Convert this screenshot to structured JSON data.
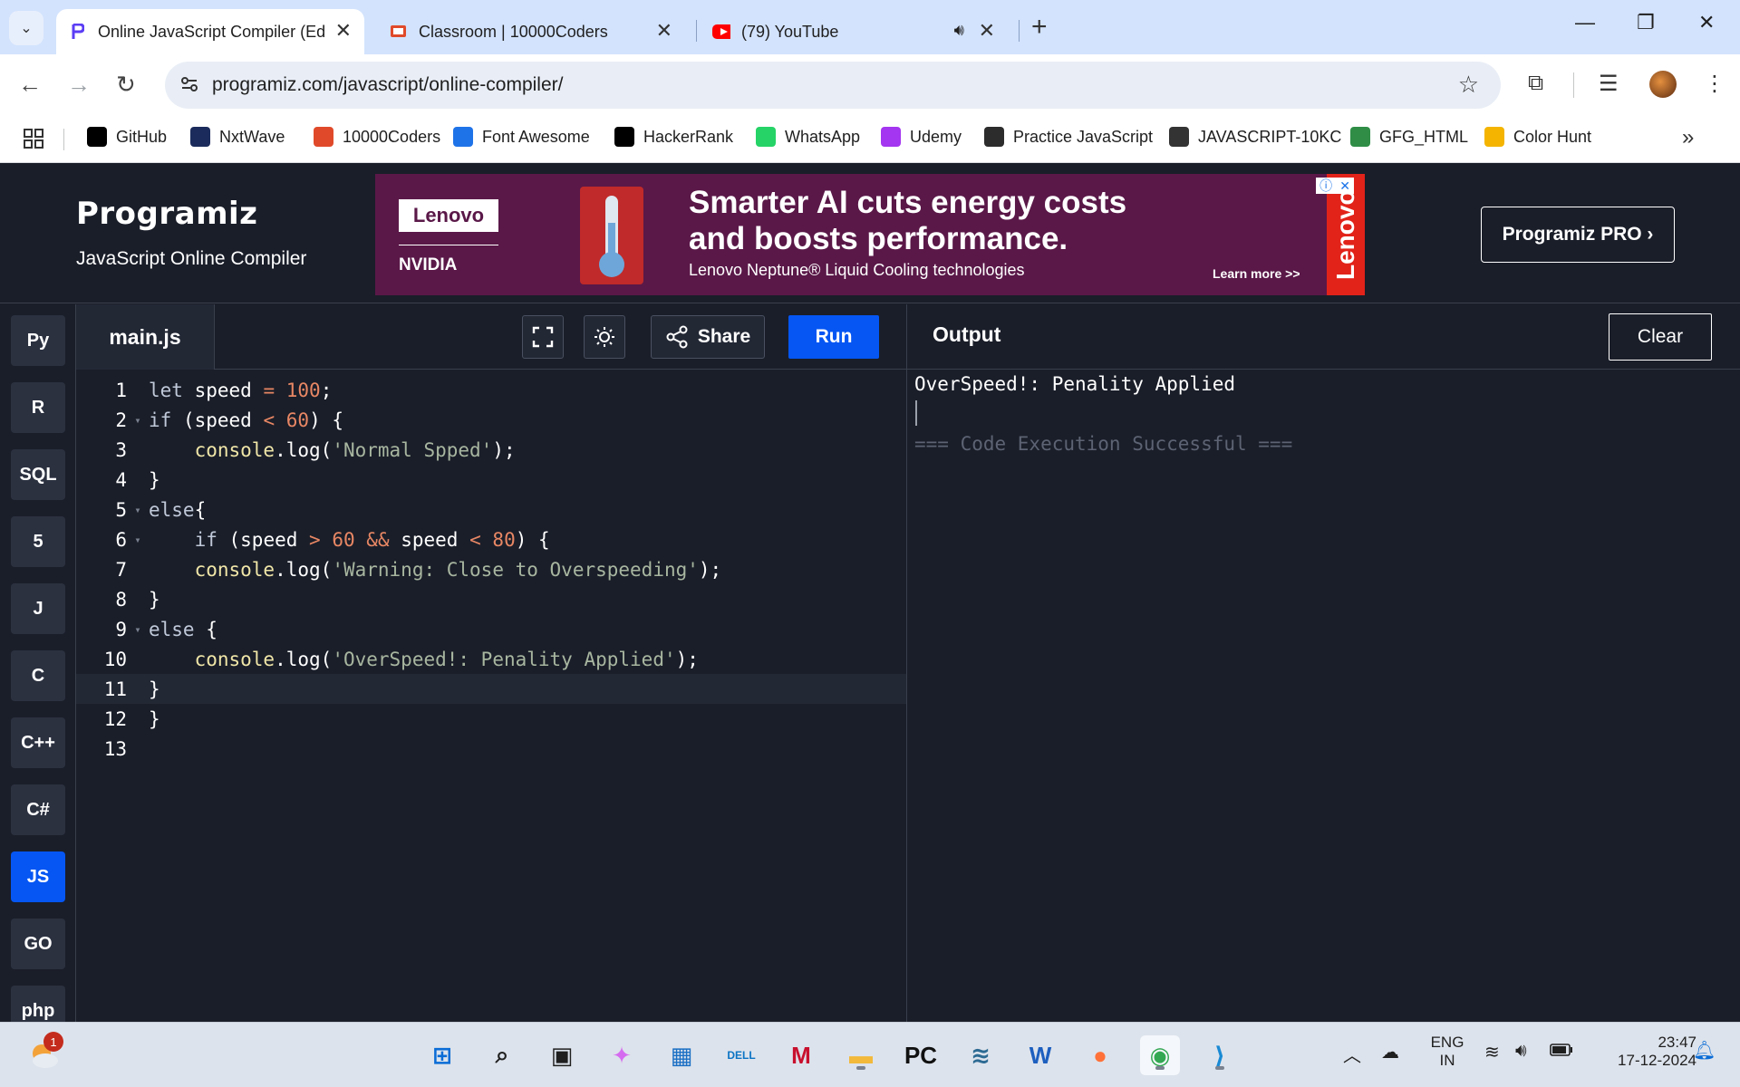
{
  "browser": {
    "tabs": [
      {
        "title": "Online JavaScript Compiler (Edi",
        "active": true
      },
      {
        "title": "Classroom | 10000Coders",
        "active": false
      },
      {
        "title": "(79) YouTube",
        "active": false
      }
    ],
    "url": "programiz.com/javascript/online-compiler/",
    "bookmarks": [
      {
        "label": "GitHub",
        "icon": "github-icon",
        "color": "#000000"
      },
      {
        "label": "NxtWave",
        "icon": "nxtwave-icon",
        "color": "#1b2b5b"
      },
      {
        "label": "10000Coders",
        "icon": "10000coders-icon",
        "color": "#e04a2a"
      },
      {
        "label": "Font Awesome",
        "icon": "flag-icon",
        "color": "#1f73e8"
      },
      {
        "label": "HackerRank",
        "icon": "hackerrank-icon",
        "color": "#000000"
      },
      {
        "label": "WhatsApp",
        "icon": "whatsapp-icon",
        "color": "#25d366"
      },
      {
        "label": "Udemy",
        "icon": "udemy-icon",
        "color": "#a435f0"
      },
      {
        "label": "Practice JavaScript",
        "icon": "codecademy-icon",
        "color": "#2c2c2c"
      },
      {
        "label": "JAVASCRIPT-10KC",
        "icon": "openai-icon",
        "color": "#333333"
      },
      {
        "label": "GFG_HTML",
        "icon": "gfg-icon",
        "color": "#2f8d46"
      },
      {
        "label": "Color Hunt",
        "icon": "colorhunt-icon",
        "color": "#f4b400"
      }
    ]
  },
  "site": {
    "logo": "Programiz",
    "subtitle": "JavaScript Online Compiler",
    "pro_button": "Programiz PRO ›",
    "ad": {
      "brand": "Lenovo",
      "partner": "NVIDIA",
      "headline_1": "Smarter AI cuts energy costs",
      "headline_2": "and boosts performance.",
      "sub": "Lenovo Neptune® Liquid Cooling technologies",
      "cta": "Learn more >>",
      "side_brand": "Lenovo"
    }
  },
  "sidebar_langs": [
    {
      "name": "python-lang-button",
      "label": "Py",
      "active": false
    },
    {
      "name": "r-lang-button",
      "label": "R",
      "active": false
    },
    {
      "name": "sql-lang-button",
      "label": "SQL",
      "active": false
    },
    {
      "name": "html-lang-button",
      "label": "5",
      "active": false
    },
    {
      "name": "java-lang-button",
      "label": "J",
      "active": false
    },
    {
      "name": "c-lang-button",
      "label": "C",
      "active": false
    },
    {
      "name": "cpp-lang-button",
      "label": "C++",
      "active": false
    },
    {
      "name": "csharp-lang-button",
      "label": "C#",
      "active": false
    },
    {
      "name": "js-lang-button",
      "label": "JS",
      "active": true
    },
    {
      "name": "go-lang-button",
      "label": "GO",
      "active": false
    },
    {
      "name": "php-lang-button",
      "label": "php",
      "active": false
    }
  ],
  "editor": {
    "filename": "main.js",
    "share_label": "Share",
    "run_label": "Run",
    "current_line": 11,
    "lines": [
      {
        "n": "1",
        "fold": false,
        "html": "<span class='kw'>let</span> speed <span class='op'>=</span> <span class='num'>100</span>;"
      },
      {
        "n": "2",
        "fold": true,
        "html": "<span class='kw'>if</span> (speed <span class='op'>&lt;</span> <span class='num'>60</span>) {"
      },
      {
        "n": "3",
        "fold": false,
        "html": "    <span class='fn'>console</span>.log(<span class='str'>'Normal Spped'</span>);"
      },
      {
        "n": "4",
        "fold": false,
        "html": "}"
      },
      {
        "n": "5",
        "fold": true,
        "html": "<span class='kw'>else</span>{"
      },
      {
        "n": "6",
        "fold": true,
        "html": "    <span class='kw'>if</span> (speed <span class='op'>&gt;</span> <span class='num'>60</span> <span class='op'>&amp;&amp;</span> speed <span class='op'>&lt;</span> <span class='num'>80</span>) {"
      },
      {
        "n": "7",
        "fold": false,
        "html": "    <span class='fn'>console</span>.log(<span class='str'>'Warning: Close to Overspeeding'</span>);"
      },
      {
        "n": "8",
        "fold": false,
        "html": "}"
      },
      {
        "n": "9",
        "fold": true,
        "html": "<span class='kw'>else</span> {"
      },
      {
        "n": "10",
        "fold": false,
        "html": "    <span class='fn'>console</span>.log(<span class='str'>'OverSpeed!: Penality Applied'</span>);"
      },
      {
        "n": "11",
        "fold": false,
        "html": "}"
      },
      {
        "n": "12",
        "fold": false,
        "html": "}"
      },
      {
        "n": "13",
        "fold": false,
        "html": ""
      }
    ]
  },
  "output": {
    "title": "Output",
    "clear_label": "Clear",
    "result": "OverSpeed!: Penality Applied",
    "status": "=== Code Execution Successful ==="
  },
  "taskbar": {
    "notification_count": "1",
    "language": "ENG",
    "region": "IN",
    "time": "23:47",
    "date": "17-12-2024",
    "apps": [
      {
        "name": "start-button",
        "label": "⊞",
        "color": "#0a6cd6"
      },
      {
        "name": "search-taskbar-icon",
        "label": "⌕",
        "color": "#1f1f1f"
      },
      {
        "name": "task-view-icon",
        "label": "▣",
        "color": "#1f1f1f"
      },
      {
        "name": "copilot-icon",
        "label": "✦",
        "color": "#d56cf0"
      },
      {
        "name": "microsoft-store-icon",
        "label": "▦",
        "color": "#1a6fc4"
      },
      {
        "name": "dell-icon",
        "label": "DELL",
        "color": "#0b74c4"
      },
      {
        "name": "mcafee-icon",
        "label": "M",
        "color": "#c8102e"
      },
      {
        "name": "file-explorer-icon",
        "label": "▬",
        "color": "#f2b93b"
      },
      {
        "name": "pycharm-icon",
        "label": "PC",
        "color": "#111111"
      },
      {
        "name": "mysql-workbench-icon",
        "label": "≋",
        "color": "#2c6a93"
      },
      {
        "name": "word-icon",
        "label": "W",
        "color": "#1d5fbf"
      },
      {
        "name": "firefox-icon",
        "label": "●",
        "color": "#ff7139"
      },
      {
        "name": "chrome-icon",
        "label": "◉",
        "color": "#34a853"
      },
      {
        "name": "vscode-icon",
        "label": "⟩",
        "color": "#1a8ad4"
      }
    ]
  }
}
